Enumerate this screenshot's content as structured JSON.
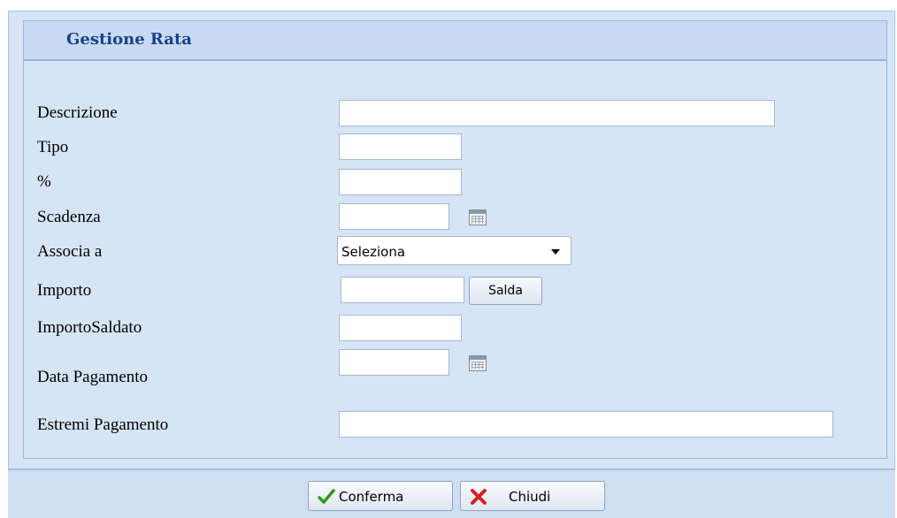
{
  "dialog": {
    "title": "Gestione Rata"
  },
  "form": {
    "descrizione": {
      "label": "Descrizione",
      "value": ""
    },
    "tipo": {
      "label": "Tipo",
      "value": ""
    },
    "percent": {
      "label": "%",
      "value": ""
    },
    "scadenza": {
      "label": "Scadenza",
      "value": ""
    },
    "associa": {
      "label": "Associa a",
      "selected": "Seleziona"
    },
    "importo": {
      "label": "Importo",
      "value": "",
      "salda_label": "Salda"
    },
    "importo_saldato": {
      "label": "ImportoSaldato",
      "value": ""
    },
    "data_pagamento": {
      "label": "Data Pagamento",
      "value": ""
    },
    "estremi_pagamento": {
      "label": "Estremi Pagamento",
      "value": ""
    }
  },
  "footer": {
    "confirm_label": "Conferma",
    "close_label": "Chiudi"
  },
  "icons": {
    "calendar": "calendar-icon",
    "confirm": "checkmark-icon",
    "close": "close-icon"
  },
  "colors": {
    "title": "#15428b",
    "panel_bg": "#d6e4f5",
    "confirm_icon": "#2e9b1f",
    "close_icon": "#d42020"
  }
}
